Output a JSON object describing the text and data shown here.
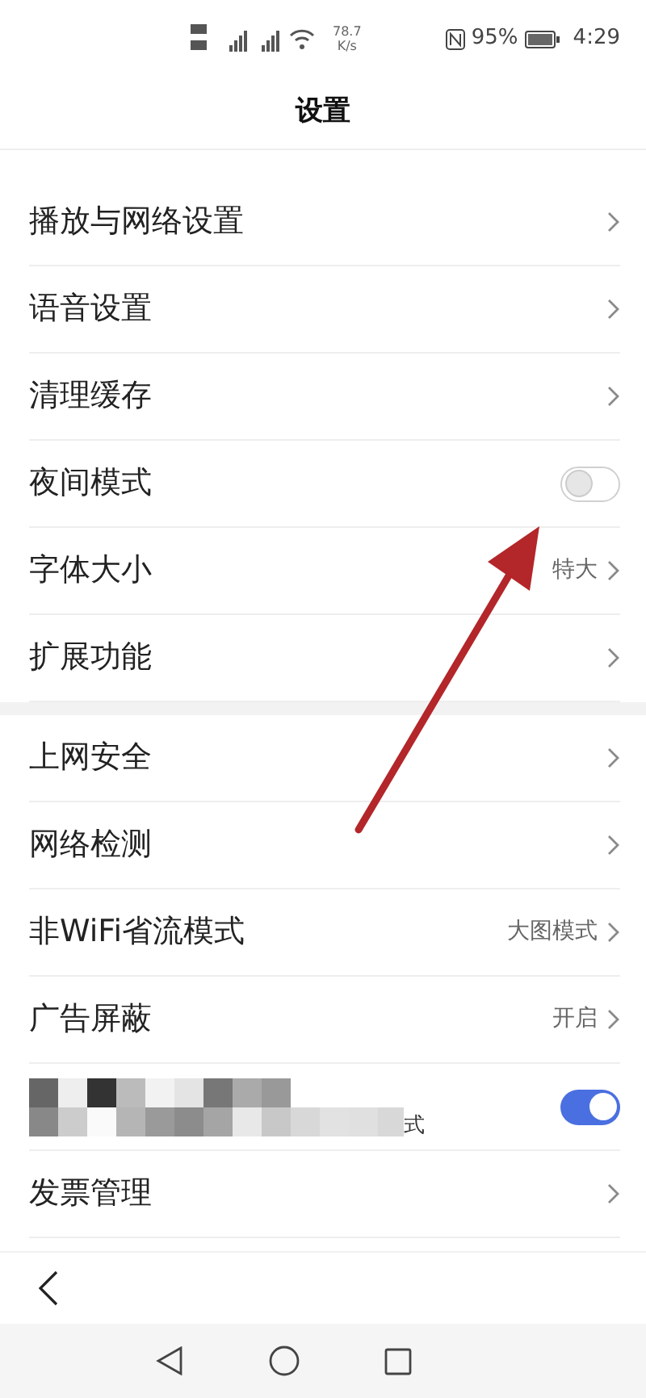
{
  "status_bar": {
    "speed": "78.7",
    "speed_unit": "K/s",
    "battery": "95%",
    "time": "4:29"
  },
  "title": "设置",
  "sections": [
    {
      "items": [
        {
          "kind": "link",
          "label": "播放与网络设置"
        },
        {
          "kind": "link",
          "label": "语音设置"
        },
        {
          "kind": "link",
          "label": "清理缓存"
        },
        {
          "kind": "toggle",
          "label": "夜间模式",
          "on": false
        },
        {
          "kind": "link",
          "label": "字体大小",
          "value": "特大"
        },
        {
          "kind": "link",
          "label": "扩展功能"
        }
      ]
    },
    {
      "items": [
        {
          "kind": "link",
          "label": "上网安全"
        },
        {
          "kind": "link",
          "label": "网络检测"
        },
        {
          "kind": "link",
          "label": "非WiFi省流模式",
          "value": "大图模式"
        },
        {
          "kind": "link",
          "label": "广告屏蔽",
          "value": "开启"
        },
        {
          "kind": "toggle",
          "label": "式",
          "redacted": true,
          "on": true
        },
        {
          "kind": "link",
          "label": "发票管理"
        }
      ]
    }
  ]
}
